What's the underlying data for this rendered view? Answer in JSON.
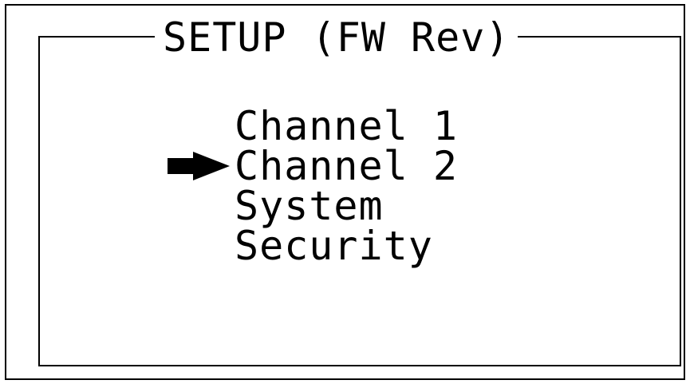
{
  "setup_menu": {
    "title": "SETUP (FW Rev)",
    "selected_index": 1,
    "items": [
      {
        "label": "Channel 1"
      },
      {
        "label": "Channel 2"
      },
      {
        "label": "System"
      },
      {
        "label": "Security"
      }
    ]
  },
  "icons": {
    "selector": "right-arrow-icon"
  },
  "colors": {
    "background": "#ffffff",
    "foreground": "#000000"
  }
}
